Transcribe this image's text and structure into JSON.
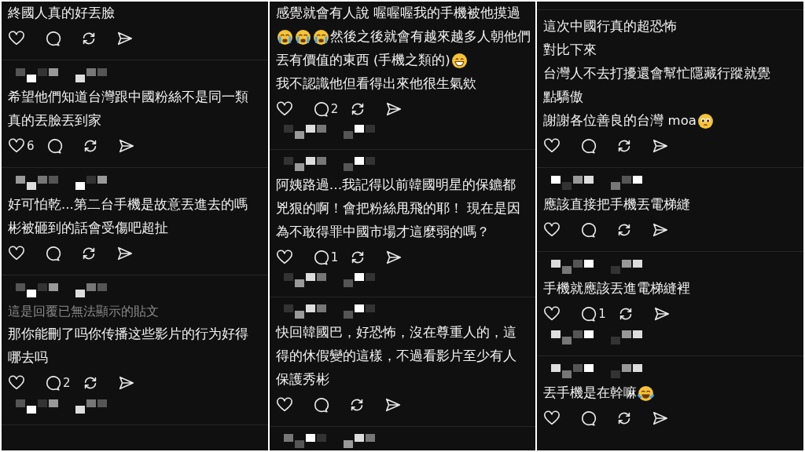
{
  "panels": [
    {
      "items": [
        {
          "kind": "post",
          "lines": [
            [
              "終國人真的好丟臉"
            ]
          ]
        },
        {
          "kind": "divider"
        },
        {
          "kind": "name"
        },
        {
          "kind": "post",
          "lines": [
            [
              "希望他們知道台灣跟中國粉絲不是同一類"
            ],
            [
              "真的丟臉丟到家"
            ]
          ],
          "likes": "6"
        },
        {
          "kind": "divider"
        },
        {
          "kind": "name"
        },
        {
          "kind": "post",
          "lines": [
            [
              "好可怕乾...第二台手機是故意丟進去的嗎"
            ],
            [
              "彬被砸到的話會受傷吧超扯"
            ]
          ]
        },
        {
          "kind": "divider"
        },
        {
          "kind": "name"
        },
        {
          "kind": "post",
          "notice": "這是回覆已無法顯示的貼文",
          "lines": [
            [
              "那你能刪了吗你传播这些影片的行为好得"
            ],
            [
              "哪去吗"
            ]
          ],
          "replies": "2"
        },
        {
          "kind": "name"
        },
        {
          "kind": "divider"
        }
      ]
    },
    {
      "items": [
        {
          "kind": "post",
          "lines": [
            [
              "感覺就會有人說 喔喔喔我的手機被他摸過"
            ],
            [
              {
                "kind": "crying"
              },
              {
                "kind": "crying"
              },
              {
                "kind": "crying"
              },
              "然後之後就會有越來越多人朝他們"
            ],
            [
              "丟有價值的東西 (手機之類的)",
              {
                "kind": "grin"
              }
            ],
            [
              "我不認識他但看得出來他很生氣欸"
            ]
          ],
          "replies": "2"
        },
        {
          "kind": "name"
        },
        {
          "kind": "divider"
        },
        {
          "kind": "name"
        },
        {
          "kind": "post",
          "lines": [
            [
              "阿姨路過…我記得以前韓國明星的保鑣都"
            ],
            [
              "兇狠的啊！會把粉絲甩飛的耶！ 現在是因"
            ],
            [
              "為不敢得罪中國市場才這麼弱的嗎？"
            ]
          ],
          "replies": "1"
        },
        {
          "kind": "name"
        },
        {
          "kind": "divider"
        },
        {
          "kind": "name"
        },
        {
          "kind": "post",
          "lines": [
            [
              "快回韓國巴，好恐怖，沒在尊重人的，這"
            ],
            [
              "得的休假變的這樣，不過看影片至少有人"
            ],
            [
              "保護秀彬"
            ]
          ]
        },
        {
          "kind": "divider"
        },
        {
          "kind": "name"
        }
      ]
    },
    {
      "items": [
        {
          "kind": "divider"
        },
        {
          "kind": "post",
          "lines": [
            [
              "這次中國行真的超恐怖"
            ],
            [
              "對比下來"
            ],
            [
              "台灣人不去打擾還會幫忙隱藏行蹤就覺"
            ],
            [
              "點驕傲"
            ],
            [
              "謝謝各位善良的台灣 moa",
              {
                "kind": "pleading"
              }
            ]
          ]
        },
        {
          "kind": "divider"
        },
        {
          "kind": "name"
        },
        {
          "kind": "post",
          "lines": [
            [
              "應該直接把手機丟電梯縫"
            ]
          ]
        },
        {
          "kind": "divider"
        },
        {
          "kind": "name"
        },
        {
          "kind": "post",
          "lines": [
            [
              "手機就應該丟進電梯縫裡"
            ]
          ],
          "replies": "1"
        },
        {
          "kind": "name"
        },
        {
          "kind": "divider"
        },
        {
          "kind": "name"
        },
        {
          "kind": "post",
          "lines": [
            [
              "丟手機是在幹嘛",
              {
                "kind": "joy"
              }
            ]
          ]
        }
      ]
    }
  ]
}
